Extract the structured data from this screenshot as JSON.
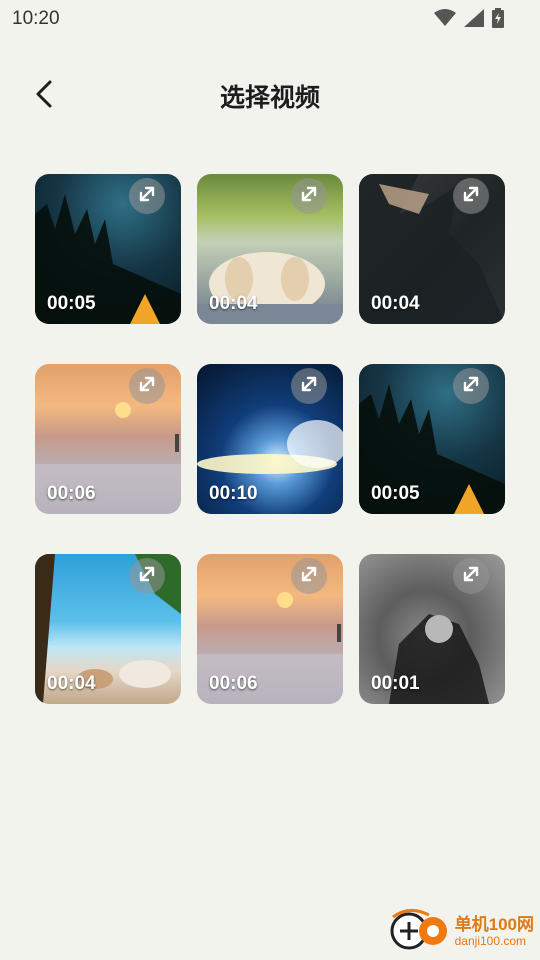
{
  "status": {
    "time": "10:20"
  },
  "header": {
    "title": "选择视频"
  },
  "videos": [
    {
      "duration": "00:05",
      "scene": "night-camp"
    },
    {
      "duration": "00:04",
      "scene": "dog"
    },
    {
      "duration": "00:04",
      "scene": "dark-art"
    },
    {
      "duration": "00:06",
      "scene": "sunset-sea"
    },
    {
      "duration": "00:10",
      "scene": "space"
    },
    {
      "duration": "00:05",
      "scene": "night-camp"
    },
    {
      "duration": "00:04",
      "scene": "beach-cats"
    },
    {
      "duration": "00:06",
      "scene": "sunset-sea"
    },
    {
      "duration": "00:01",
      "scene": "gray-figure"
    }
  ],
  "watermark": {
    "main": "单机100网",
    "sub": "danji100.com"
  }
}
